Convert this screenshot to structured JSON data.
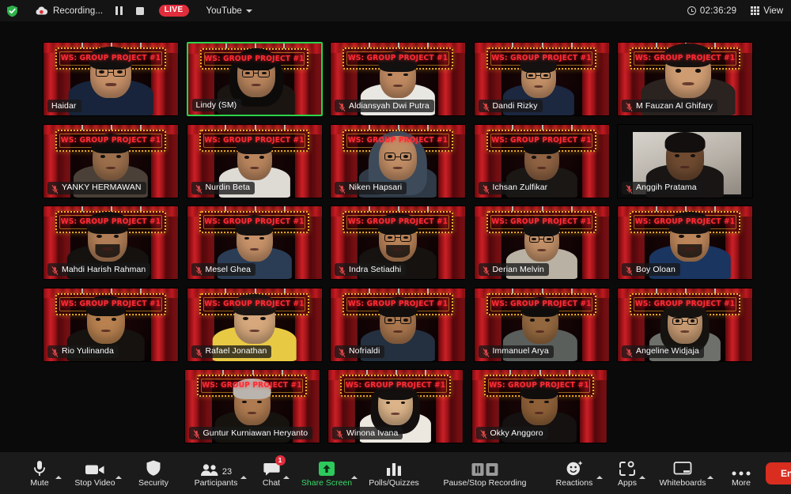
{
  "topbar": {
    "shield_icon": "shield-check-icon",
    "cloud_icon": "cloud-recording-icon",
    "recording_label": "Recording...",
    "pause_icon": "pause-icon",
    "stop_icon": "stop-icon",
    "live_label": "LIVE",
    "platform_label": "YouTube",
    "platform_caret_icon": "chevron-down-icon",
    "clock_icon": "clock-icon",
    "elapsed_time": "02:36:29",
    "view_icon": "grid-view-icon",
    "view_label": "View"
  },
  "virtual_background": {
    "marquee_text": "WS: GROUP PROJECT #1",
    "accent_gold": "#f0b429",
    "curtain_red": "#c0161d",
    "text_red": "#ff2b34"
  },
  "grid": {
    "active_speaker_color": "#2bd44a",
    "rows": [
      [
        {
          "name": "Haidar",
          "muted": false,
          "active": false,
          "vbg": true,
          "skin": "#c79068",
          "hair": "#12100f",
          "shirt": "#17243b",
          "glasses": true,
          "head_w": 52,
          "head_h": 62,
          "offset": 0
        },
        {
          "name": "Lindy (SM)",
          "muted": false,
          "active": true,
          "vbg": true,
          "skin": "#b7835c",
          "hair": "#0d0b0a",
          "shirt": "#1b1512",
          "glasses": true,
          "head_w": 48,
          "head_h": 58,
          "offset": 2,
          "longhair": true
        },
        {
          "name": "Aldiansyah Dwi Putra",
          "muted": true,
          "active": false,
          "vbg": true,
          "skin": "#c08a61",
          "hair": "#131010",
          "shirt": "#e9e7e2",
          "glasses": false,
          "head_w": 46,
          "head_h": 56,
          "offset": 0
        },
        {
          "name": "Dandi Rizky",
          "muted": true,
          "active": false,
          "vbg": true,
          "skin": "#c49067",
          "hair": "#141110",
          "shirt": "#1c2740",
          "glasses": true,
          "head_w": 44,
          "head_h": 54,
          "offset": -4
        },
        {
          "name": "M Fauzan Al Ghifary",
          "muted": true,
          "active": false,
          "vbg": true,
          "skin": "#cf9c72",
          "hair": "#15110f",
          "shirt": "#2a2320",
          "glasses": false,
          "head_w": 58,
          "head_h": 66,
          "offset": 4
        }
      ],
      [
        {
          "name": "YANKY HERMAWAN",
          "muted": true,
          "active": false,
          "vbg": true,
          "skin": "#9c6f4c",
          "hair": "#0f0d0c",
          "shirt": "#4a4038",
          "glasses": false,
          "head_w": 46,
          "head_h": 56,
          "offset": 0
        },
        {
          "name": "Nurdin Beta",
          "muted": true,
          "active": false,
          "vbg": true,
          "skin": "#b9855d",
          "hair": "#120f0e",
          "shirt": "#dedbd5",
          "glasses": false,
          "head_w": 44,
          "head_h": 54,
          "offset": 0
        },
        {
          "name": "Niken Hapsari",
          "muted": true,
          "active": false,
          "vbg": true,
          "skin": "#c08c64",
          "hair": "#3d4a5a",
          "shirt": "#2f3a46",
          "glasses": true,
          "head_w": 48,
          "head_h": 56,
          "offset": 0,
          "hijab": true
        },
        {
          "name": "Ichsan Zulfikar",
          "muted": true,
          "active": false,
          "vbg": true,
          "skin": "#8f6242",
          "hair": "#0e0c0b",
          "shirt": "#1a1715",
          "glasses": false,
          "head_w": 44,
          "head_h": 54,
          "offset": 0
        },
        {
          "name": "Anggih Pratama",
          "muted": true,
          "active": false,
          "vbg": false,
          "skin": "#6e4a30",
          "hair": "#120f0e",
          "shirt": "#181514",
          "glasses": false,
          "head_w": 48,
          "head_h": 58,
          "offset": 0
        }
      ],
      [
        {
          "name": "Mahdi Harish Rahman",
          "muted": true,
          "active": false,
          "vbg": true,
          "skin": "#b07d56",
          "hair": "#100e0d",
          "shirt": "#14110f",
          "glasses": false,
          "head_w": 50,
          "head_h": 60,
          "offset": -4,
          "beard": true
        },
        {
          "name": "Mesel Ghea",
          "muted": true,
          "active": false,
          "vbg": true,
          "skin": "#c79269",
          "hair": "#141110",
          "shirt": "#2b3d55",
          "glasses": false,
          "head_w": 46,
          "head_h": 56,
          "offset": 0
        },
        {
          "name": "Indra Setiadhi",
          "muted": true,
          "active": false,
          "vbg": true,
          "skin": "#b98156",
          "hair": "#110f0e",
          "shirt": "#15120f",
          "glasses": true,
          "head_w": 48,
          "head_h": 58,
          "offset": 0,
          "beard": true
        },
        {
          "name": "Derian Melvin",
          "muted": true,
          "active": false,
          "vbg": true,
          "skin": "#c29068",
          "hair": "#131110",
          "shirt": "#b9b2a4",
          "glasses": true,
          "head_w": 44,
          "head_h": 54,
          "offset": 0
        },
        {
          "name": "Boy Oloan",
          "muted": true,
          "active": false,
          "vbg": true,
          "skin": "#bb8559",
          "hair": "#120f0e",
          "shirt": "#1a3560",
          "glasses": false,
          "head_w": 50,
          "head_h": 60,
          "offset": 6,
          "beard": true
        }
      ],
      [
        {
          "name": "Rio Yulinanda",
          "muted": true,
          "active": false,
          "vbg": true,
          "skin": "#b8814f",
          "hair": "#110e0d",
          "shirt": "#15120f",
          "glasses": false,
          "head_w": 48,
          "head_h": 58,
          "offset": -6
        },
        {
          "name": "Rafael Jonathan",
          "muted": true,
          "active": false,
          "vbg": true,
          "skin": "#d6a87c",
          "hair": "#1a1512",
          "shirt": "#e8c944",
          "glasses": false,
          "head_w": 52,
          "head_h": 60,
          "offset": 0
        },
        {
          "name": "Nofrialdi",
          "muted": true,
          "active": false,
          "vbg": true,
          "skin": "#a9764d",
          "hair": "#110e0d",
          "shirt": "#24303f",
          "glasses": true,
          "head_w": 46,
          "head_h": 56,
          "offset": 0
        },
        {
          "name": "Immanuel Arya",
          "muted": true,
          "active": false,
          "vbg": true,
          "skin": "#94683f",
          "hair": "#0f0d0c",
          "shirt": "#5a5f5c",
          "glasses": false,
          "head_w": 46,
          "head_h": 56,
          "offset": -2
        },
        {
          "name": "Angeline Widjaja",
          "muted": true,
          "active": false,
          "vbg": true,
          "skin": "#c79a72",
          "hair": "#15120f",
          "shirt": "#6d706b",
          "glasses": true,
          "head_w": 44,
          "head_h": 54,
          "offset": 0,
          "longhair": true
        }
      ],
      [
        {
          "name": "Guntur Kurniawan Heryanto",
          "muted": true,
          "active": false,
          "vbg": true,
          "skin": "#b07b50",
          "hair": "#b9b4ad",
          "shirt": "#16130f",
          "glasses": false,
          "head_w": 46,
          "head_h": 56,
          "offset": 0
        },
        {
          "name": "Winona Ivana",
          "muted": true,
          "active": false,
          "vbg": true,
          "skin": "#dcb489",
          "hair": "#120f0e",
          "shirt": "#ece7df",
          "glasses": false,
          "head_w": 44,
          "head_h": 54,
          "offset": 0,
          "longhair": true
        },
        {
          "name": "Okky Anggoro",
          "muted": true,
          "active": false,
          "vbg": true,
          "skin": "#8e6038",
          "hair": "#100e0d",
          "shirt": "#141110",
          "glasses": false,
          "head_w": 46,
          "head_h": 56,
          "offset": 0
        }
      ]
    ]
  },
  "toolbar": {
    "items": [
      {
        "key": "mute",
        "label": "Mute",
        "icon": "microphone-icon",
        "caret": true,
        "badge": null,
        "count": null,
        "green": false
      },
      {
        "key": "video",
        "label": "Stop Video",
        "icon": "video-camera-icon",
        "caret": true,
        "badge": null,
        "count": null,
        "green": false
      },
      {
        "key": "security",
        "label": "Security",
        "icon": "shield-icon",
        "caret": false,
        "badge": null,
        "count": null,
        "green": false
      },
      {
        "key": "participants",
        "label": "Participants",
        "icon": "people-icon",
        "caret": true,
        "badge": null,
        "count": "23",
        "green": false
      },
      {
        "key": "chat",
        "label": "Chat",
        "icon": "chat-bubble-icon",
        "caret": true,
        "badge": "1",
        "count": null,
        "green": false
      },
      {
        "key": "share",
        "label": "Share Screen",
        "icon": "share-screen-icon",
        "caret": true,
        "badge": null,
        "count": null,
        "green": true
      },
      {
        "key": "polls",
        "label": "Polls/Quizzes",
        "icon": "bar-chart-icon",
        "caret": false,
        "badge": null,
        "count": null,
        "green": false
      },
      {
        "key": "recording",
        "label": "Pause/Stop Recording",
        "icon": "pause-stop-recording-icon",
        "caret": false,
        "badge": null,
        "count": null,
        "green": false
      },
      {
        "key": "reactions",
        "label": "Reactions",
        "icon": "reactions-smiley-icon",
        "caret": true,
        "badge": null,
        "count": null,
        "green": false
      },
      {
        "key": "apps",
        "label": "Apps",
        "icon": "apps-icon",
        "caret": true,
        "badge": null,
        "count": null,
        "green": false
      },
      {
        "key": "whiteboards",
        "label": "Whiteboards",
        "icon": "whiteboard-icon",
        "caret": true,
        "badge": null,
        "count": null,
        "green": false
      },
      {
        "key": "more",
        "label": "More",
        "icon": "ellipsis-icon",
        "caret": false,
        "badge": null,
        "count": null,
        "green": false
      }
    ],
    "end_label": "End",
    "end_color": "#d92d20"
  }
}
